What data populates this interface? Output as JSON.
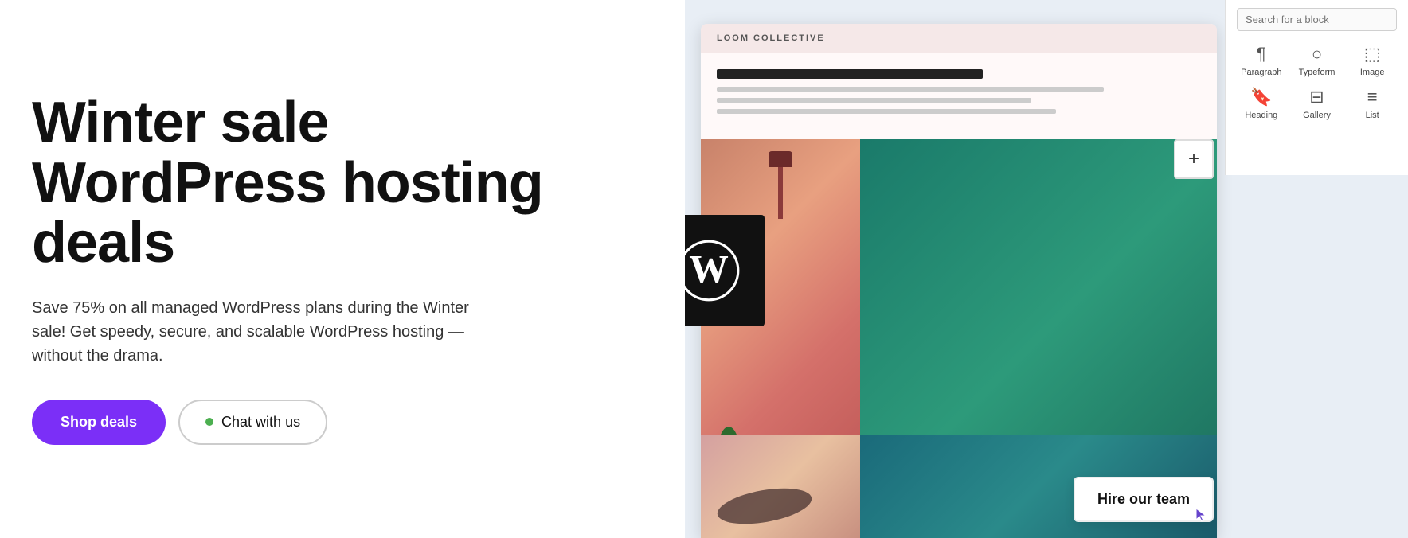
{
  "left": {
    "hero_title": "Winter sale WordPress hosting deals",
    "description": "Save 75% on all managed WordPress plans during the Winter sale! Get speedy, secure, and scalable WordPress hosting — without the drama.",
    "btn_shop": "Shop deals",
    "btn_chat": "Chat with us",
    "chat_dot_color": "#4caf50"
  },
  "right": {
    "editor": {
      "site_name": "LOOM COLLECTIVE",
      "search_placeholder": "Search for a block",
      "blocks": [
        {
          "id": "paragraph",
          "label": "Paragraph",
          "icon": "¶"
        },
        {
          "id": "typeform",
          "label": "Typeform",
          "icon": "○"
        },
        {
          "id": "image",
          "label": "Image",
          "icon": "⬚"
        },
        {
          "id": "heading",
          "label": "Heading",
          "icon": "🔖"
        },
        {
          "id": "gallery",
          "label": "Gallery",
          "icon": "⊟"
        },
        {
          "id": "list",
          "label": "List",
          "icon": "≡"
        }
      ],
      "add_block_label": "+",
      "hire_team_label": "Hire our team"
    }
  }
}
